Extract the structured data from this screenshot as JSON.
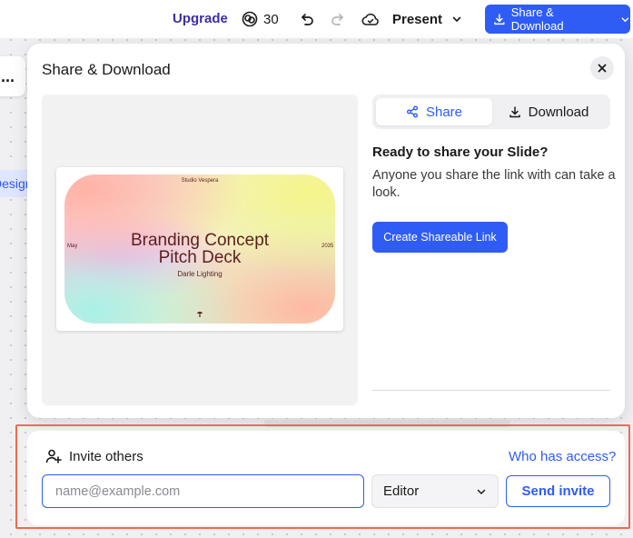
{
  "topbar": {
    "upgrade_label": "Upgrade",
    "credits_count": "30",
    "present_label": "Present",
    "share_download_label": "Share & Download",
    "icons": [
      "credits-icon",
      "undo-icon",
      "redo-icon",
      "cloud-sync-icon",
      "chevron-down-icon",
      "download-icon"
    ]
  },
  "canvas": {
    "menu_label": "...",
    "design_label": "Design"
  },
  "modal": {
    "title": "Share & Download",
    "tabs": [
      {
        "label": "Share",
        "icon": "share-icon",
        "active": true
      },
      {
        "label": "Download",
        "icon": "download-icon",
        "active": false
      }
    ],
    "share_heading": "Ready to share your Slide?",
    "share_description": "Anyone you share the link with can take a look.",
    "create_link_label": "Create Shareable Link"
  },
  "slide_preview": {
    "studio": "Studio Vespera",
    "title_line1": "Branding Concept",
    "title_line2": "Pitch Deck",
    "subtitle": "Darle Lighting",
    "left_label": "May",
    "right_label": "2035"
  },
  "invite": {
    "heading": "Invite others",
    "who_has_access_label": "Who has access?",
    "email_placeholder": "name@example.com",
    "email_value": "",
    "role_value": "Editor",
    "send_label": "Send invite"
  },
  "colors": {
    "accent": "#2f5cf5",
    "upgrade": "#3b2fa6",
    "highlight": "#ee6a52",
    "slide_text": "#5b1f1f"
  }
}
